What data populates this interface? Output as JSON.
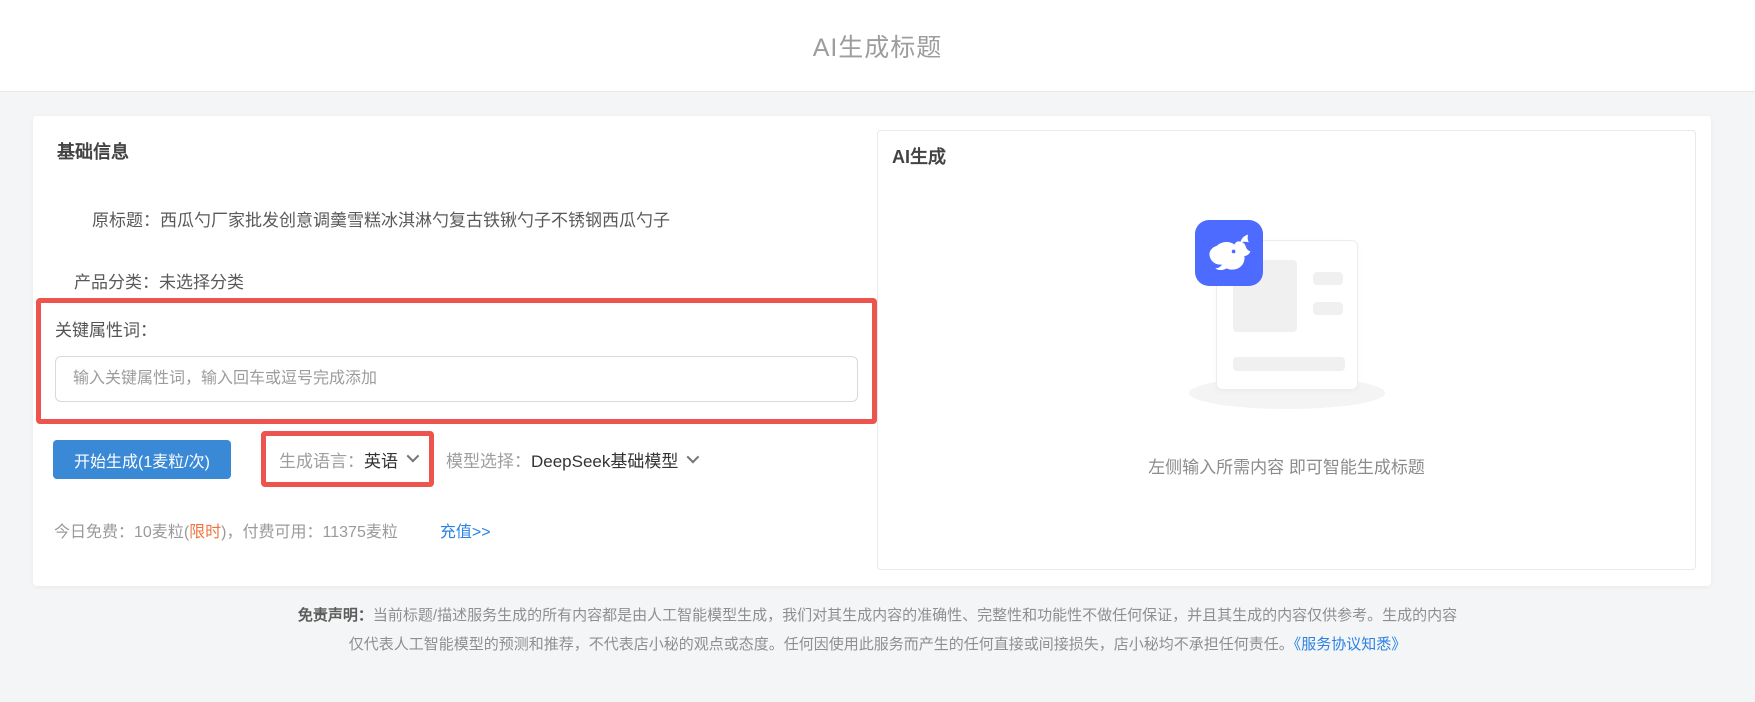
{
  "page": {
    "title": "AI生成标题"
  },
  "basic_info": {
    "section_title": "基础信息",
    "original_title_label": "原标题：",
    "original_title_value": "西瓜勺厂家批发创意调羹雪糕冰淇淋勺复古铁锹勺子不锈钢西瓜勺子",
    "category_label": "产品分类：",
    "category_value": "未选择分类",
    "keywords_label": "关键属性词：",
    "keywords_placeholder": "输入关键属性词，输入回车或逗号完成添加",
    "keywords_value": "",
    "generate_button": "开始生成(1麦粒/次)",
    "language_label": "生成语言：",
    "language_value": "英语",
    "model_label": "模型选择：",
    "model_value": "DeepSeek基础模型",
    "credits": {
      "free_label": "今日免费：",
      "free_amount": "10麦粒(",
      "free_tag": "限时",
      "free_close": ")，",
      "paid_label": "付费可用：",
      "paid_amount": "11375麦粒",
      "recharge_link": "充值>>"
    }
  },
  "ai_panel": {
    "section_title": "AI生成",
    "caption": "左侧输入所需内容 即可智能生成标题",
    "badge_icon": "deepseek-whale"
  },
  "disclaimer": {
    "label": "免责声明：",
    "line1": "当前标题/描述服务生成的所有内容都是由人工智能模型生成，我们对其生成内容的准确性、完整性和功能性不做任何保证，并且其生成的内容仅供参考。生成的内容",
    "line2": "仅代表人工智能模型的预测和推荐，不代表店小秘的观点或态度。任何因使用此服务而产生的任何直接或间接损失，店小秘均不承担任何责任。",
    "agreement_link": "《服务协议知悉》"
  },
  "colors": {
    "highlight_red": "#ed544d",
    "primary_button_blue": "#3a89d6",
    "deepseek_badge_blue": "#4d6bfe",
    "link_blue": "#2a82e4",
    "limited_time_orange": "#f0753f"
  }
}
